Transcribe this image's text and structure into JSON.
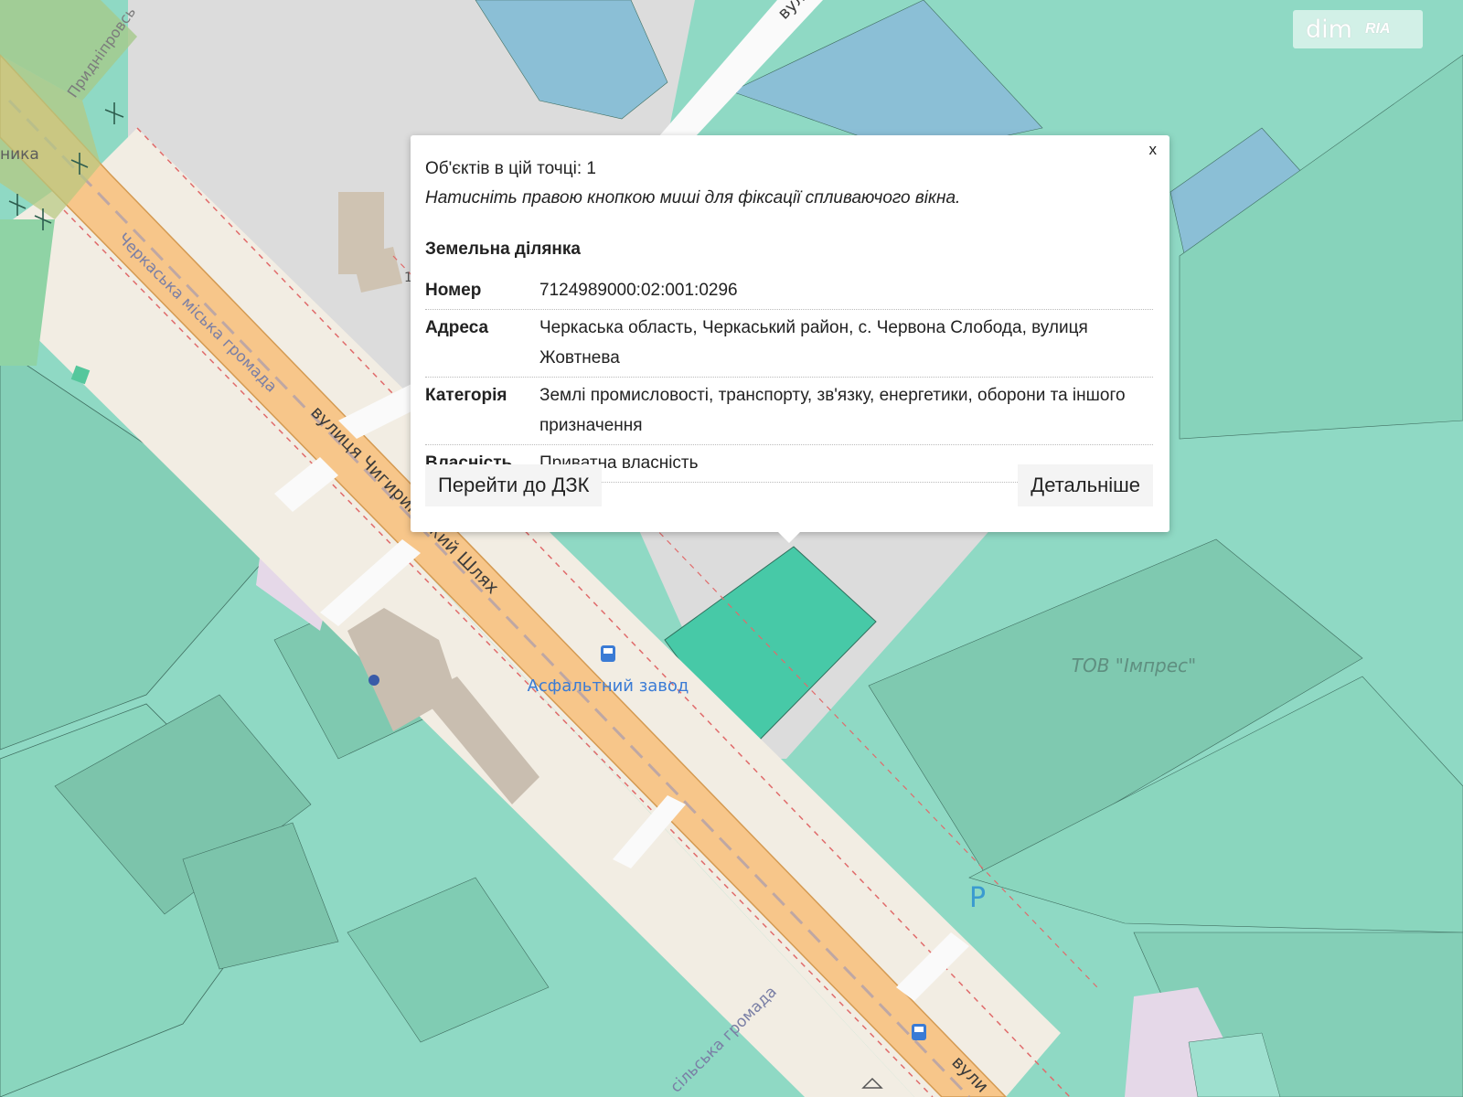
{
  "map": {
    "labels": {
      "street_main": "вулиця Чигиринський Шлях",
      "street_main_2": "вули",
      "street_top": "вул",
      "street_left": "Придніпровсь",
      "area_left": "ника",
      "community_1": "Черкаська міська громада",
      "community_2": "сільська громада",
      "bus_stop": "Асфальтний завод",
      "company": "ТОВ \"Імпрес\"",
      "parking": "P",
      "digit": "1"
    }
  },
  "popup": {
    "count_text": "Об'єктів в цій точці: 1",
    "hint_text": "Натисніть правою кнопкою миші для фіксації спливаючого вікна.",
    "close_label": "x",
    "section_title": "Земельна ділянка",
    "properties": [
      {
        "key": "Номер",
        "value": "7124989000:02:001:0296"
      },
      {
        "key": "Адреса",
        "value": "Черкаська область, Черкаський район, с. Червона Слобода, вулиця Жовтнева"
      },
      {
        "key": "Категорія",
        "value": "Землі промисловості, транспорту, зв'язку, енергетики, оборони та іншого призначення"
      },
      {
        "key": "Власність",
        "value": "Приватна власність"
      }
    ],
    "btn_dzk": "Перейти до ДЗК",
    "btn_details": "Детальніше"
  },
  "watermark": {
    "brand": "dim",
    "brand2": "RIA"
  },
  "colors": {
    "parcel_green": "#8fd9c4",
    "parcel_dark": "#7fc8b0",
    "selected_parcel": "#47c9a7",
    "blue_parcel": "#8bbfd6",
    "road_main": "#f7c68a",
    "road_side": "#f2ede3",
    "gray_area": "#dcdcdc",
    "pink_area": "#e5d8e8",
    "text_map": "#5a6c8f"
  }
}
